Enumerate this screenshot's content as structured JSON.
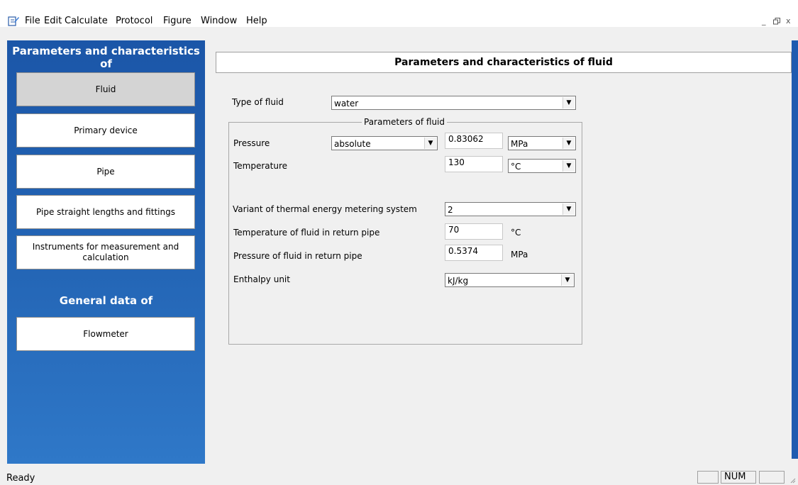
{
  "menu": {
    "items": [
      "File",
      "Edit",
      "Calculate",
      "Protocol",
      "Figure",
      "Window",
      "Help"
    ],
    "window_buttons": {
      "minimize": "_",
      "restore": "̅̅□",
      "close": "x"
    }
  },
  "sidebar": {
    "heading1": "Parameters and characteristics of",
    "items": [
      "Fluid",
      "Primary device",
      "Pipe",
      "Pipe straight lengths and fittings",
      "Instruments for measurement and calculation"
    ],
    "active": "Fluid",
    "heading2": "General data of",
    "general_items": [
      "Flowmeter"
    ]
  },
  "main": {
    "title": "Parameters and characteristics of fluid",
    "fluid_type": {
      "label": "Type of fluid",
      "value": "water"
    },
    "group_title": "Parameters of fluid",
    "pressure": {
      "label": "Pressure",
      "mode": "absolute",
      "value": "0.83062",
      "unit": "MPa"
    },
    "temperature": {
      "label": "Temperature",
      "value": "130",
      "unit": "°C"
    },
    "variant": {
      "label": "Variant of thermal energy metering system",
      "value": "2"
    },
    "return_temperature": {
      "label": "Temperature of fluid in return pipe",
      "value": "70",
      "unit": "°C"
    },
    "return_pressure": {
      "label": "Pressure of fluid in return pipe",
      "value": "0.5374",
      "unit": "MPa"
    },
    "enthalpy": {
      "label": "Enthalpy unit",
      "value": "kJ/kg"
    }
  },
  "statusbar": {
    "text": "Ready",
    "num": "NUM"
  },
  "colors": {
    "sidebar_top": "#1b56a8",
    "sidebar_bottom": "#2f78c8",
    "active_button": "#d4d4d4"
  }
}
